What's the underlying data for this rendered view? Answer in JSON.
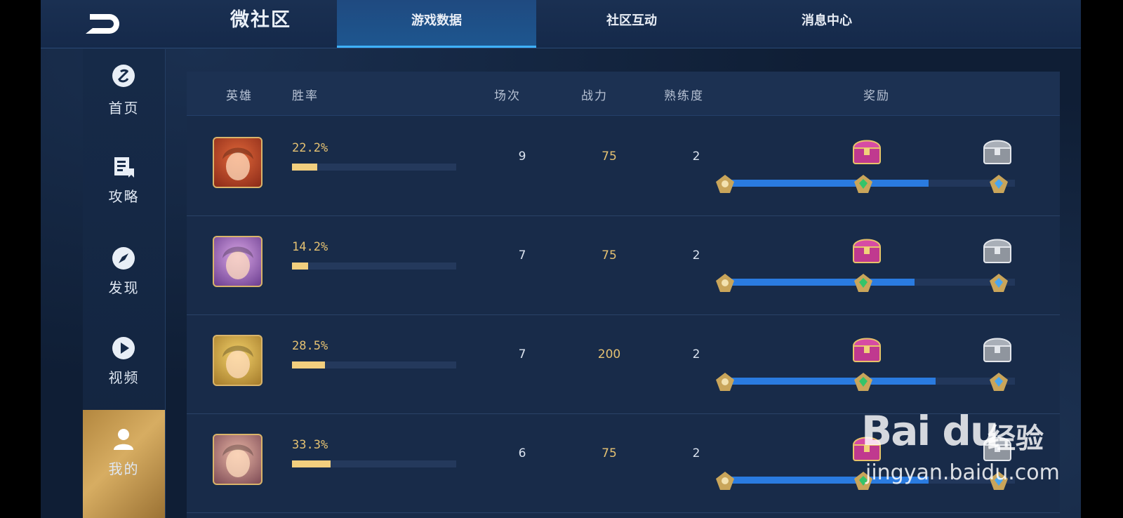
{
  "header": {
    "title": "微社区",
    "tabs": [
      {
        "label": "游戏数据",
        "active": true
      },
      {
        "label": "社区互动",
        "active": false
      },
      {
        "label": "消息中心",
        "active": false
      }
    ]
  },
  "sidebar": {
    "items": [
      {
        "label": "首页",
        "icon": "home-icon",
        "active": false
      },
      {
        "label": "攻略",
        "icon": "guide-icon",
        "active": false
      },
      {
        "label": "发现",
        "icon": "compass-icon",
        "active": false
      },
      {
        "label": "视频",
        "icon": "play-icon",
        "active": false
      },
      {
        "label": "我的",
        "icon": "user-icon",
        "active": true
      }
    ]
  },
  "table": {
    "columns": [
      "英雄",
      "胜率",
      "场次",
      "战力",
      "熟练度",
      "奖励"
    ],
    "rows": [
      {
        "hero": "hero-1",
        "winrate": "22.2%",
        "winrate_value": 0.222,
        "matches": "9",
        "power": "75",
        "proficiency": "2",
        "reward_progress": 0.695
      },
      {
        "hero": "hero-2",
        "winrate": "14.2%",
        "winrate_value": 0.142,
        "matches": "7",
        "power": "75",
        "proficiency": "2",
        "reward_progress": 0.645
      },
      {
        "hero": "hero-3",
        "winrate": "28.5%",
        "winrate_value": 0.285,
        "matches": "7",
        "power": "200",
        "proficiency": "2",
        "reward_progress": 0.72
      },
      {
        "hero": "hero-4",
        "winrate": "33.3%",
        "winrate_value": 0.333,
        "matches": "6",
        "power": "75",
        "proficiency": "2",
        "reward_progress": 0.695
      }
    ]
  },
  "watermark": {
    "logo": "Bai du",
    "cn": "经验",
    "url": "jingyan.baidu.com"
  },
  "colors": {
    "accent": "#3fb2ff",
    "gold": "#e4c172",
    "progress": "#2a7be0",
    "winbar": "#f2cf7e"
  }
}
